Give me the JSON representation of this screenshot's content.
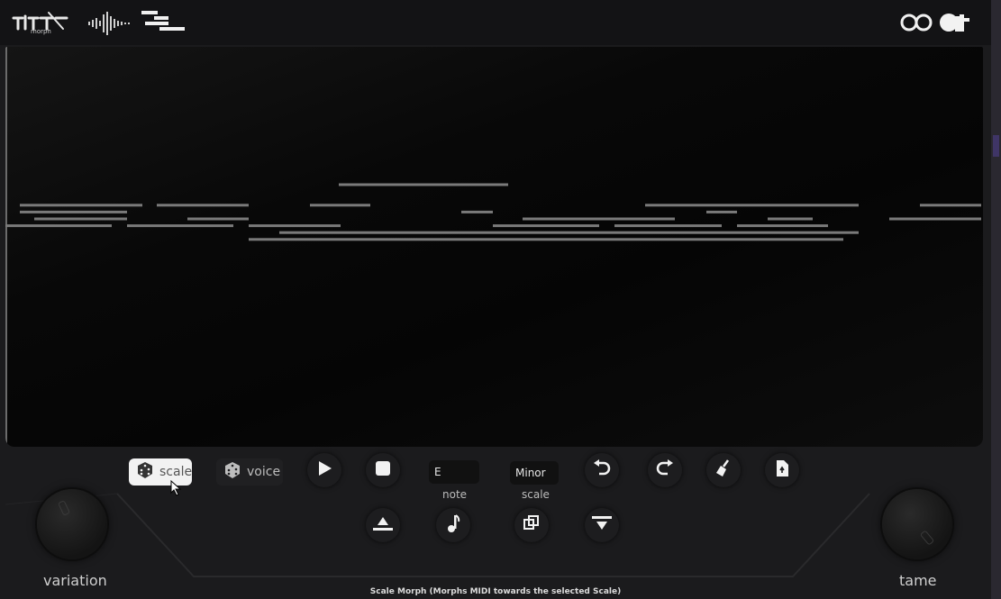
{
  "header": {
    "logos": [
      "midi-morph-logo",
      "waveform-logo",
      "piano-roll-logo"
    ],
    "brand": "aT"
  },
  "colors": {
    "note": "#7a7a7a",
    "accent": "#3f3566"
  },
  "roll": {
    "notes": [
      {
        "pitch": 69,
        "start": 370.0,
        "end": 558.0
      },
      {
        "pitch": 66,
        "start": 16.0,
        "end": 152.0
      },
      {
        "pitch": 66,
        "start": 168.0,
        "end": 270.0
      },
      {
        "pitch": 66,
        "start": 338.0,
        "end": 405.0
      },
      {
        "pitch": 66,
        "start": 710.0,
        "end": 947.0
      },
      {
        "pitch": 66,
        "start": 1015.0,
        "end": 1083.0
      },
      {
        "pitch": 65,
        "start": 16.0,
        "end": 135.0
      },
      {
        "pitch": 65,
        "start": 506.0,
        "end": 541.0
      },
      {
        "pitch": 65,
        "start": 778.0,
        "end": 812.0
      },
      {
        "pitch": 64,
        "start": 32.0,
        "end": 135.0
      },
      {
        "pitch": 64,
        "start": 202.0,
        "end": 270.0
      },
      {
        "pitch": 64,
        "start": 574.0,
        "end": 743.0
      },
      {
        "pitch": 64,
        "start": 846.0,
        "end": 896.0
      },
      {
        "pitch": 64,
        "start": 981.0,
        "end": 1083.0
      },
      {
        "pitch": 63,
        "start": 0.0,
        "end": 118.0
      },
      {
        "pitch": 63,
        "start": 135.0,
        "end": 253.0
      },
      {
        "pitch": 63,
        "start": 270.0,
        "end": 372.0
      },
      {
        "pitch": 63,
        "start": 541.0,
        "end": 659.0
      },
      {
        "pitch": 63,
        "start": 676.0,
        "end": 795.0
      },
      {
        "pitch": 63,
        "start": 812.0,
        "end": 913.0
      },
      {
        "pitch": 62,
        "start": 304.0,
        "end": 541.0
      },
      {
        "pitch": 62,
        "start": 541.0,
        "end": 947.0
      },
      {
        "pitch": 61,
        "start": 270.0,
        "end": 930.0
      }
    ]
  },
  "controls": {
    "scale_button": "scale",
    "voice_button": "voice",
    "note_value": "E",
    "note_label": "note",
    "scale_value": "Minor",
    "scale_label": "scale"
  },
  "knobs": {
    "variation_label": "variation",
    "tame_label": "tame"
  },
  "status": "Scale Morph (Morphs MIDI towards the selected Scale)"
}
